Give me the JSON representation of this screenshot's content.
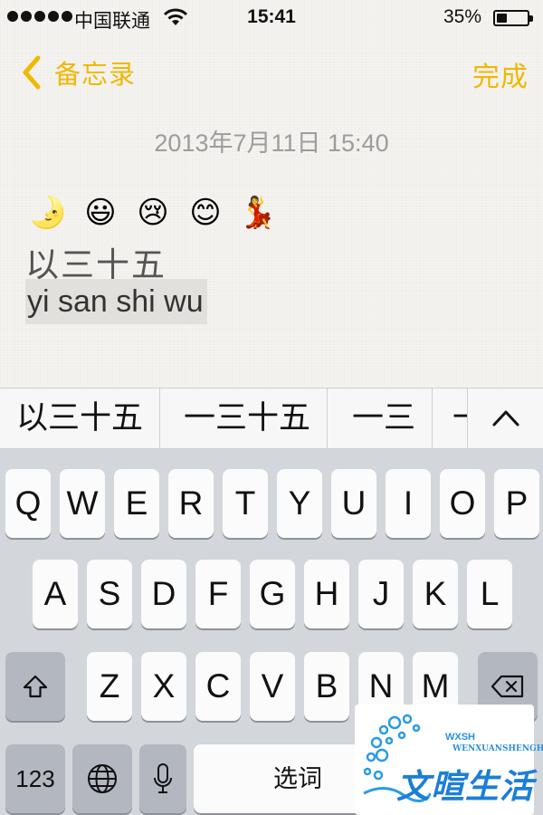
{
  "status_bar": {
    "carrier": "中国联通",
    "time": "15:41",
    "battery_percent_label": "35%",
    "battery_level": 0.35,
    "signal_bars": 5
  },
  "nav": {
    "back_label": "备忘录",
    "done_label": "完成",
    "accent_color": "#f0b800"
  },
  "note": {
    "date": "2013年7月11日 15:40",
    "emojis": [
      "🌛",
      "😃",
      "😢",
      "😊",
      "💃"
    ],
    "line1": "以三十五",
    "composing": "yi san shi wu"
  },
  "candidates": [
    "以三十五",
    "一三十五",
    "一三",
    "一"
  ],
  "keyboard": {
    "row1": [
      "Q",
      "W",
      "E",
      "R",
      "T",
      "Y",
      "U",
      "I",
      "O",
      "P"
    ],
    "row2": [
      "A",
      "S",
      "D",
      "F",
      "G",
      "H",
      "J",
      "K",
      "L"
    ],
    "row3": [
      "Z",
      "X",
      "C",
      "V",
      "B",
      "N",
      "M"
    ],
    "numbers_label": "123",
    "space_label": "选词",
    "icons": {
      "shift": "shift-icon",
      "delete": "delete-icon",
      "globe": "globe-icon",
      "mic": "microphone-icon",
      "expand": "chevron-up-icon"
    }
  },
  "watermark": {
    "title": "文暄生活",
    "initials": "WXSH",
    "pinyin": "WENXUANSHENGHUO"
  }
}
